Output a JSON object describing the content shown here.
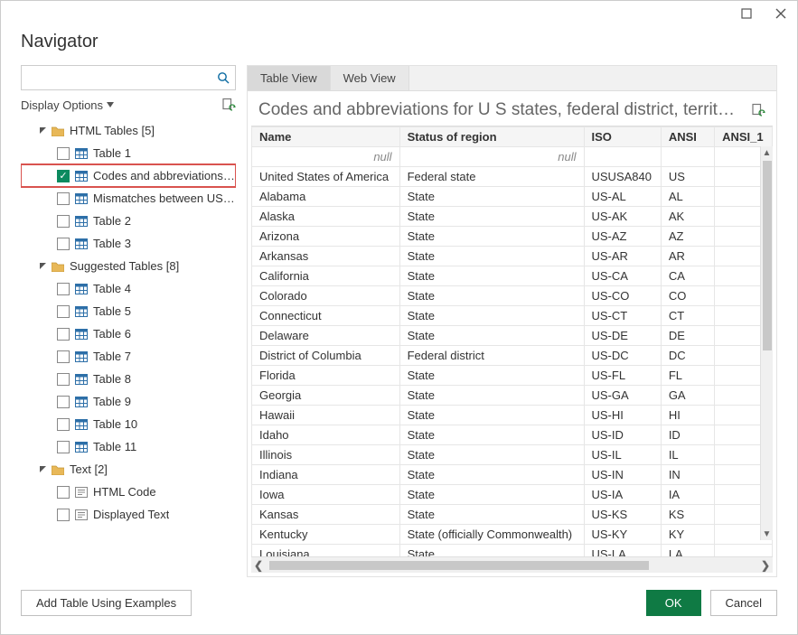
{
  "window": {
    "title": "Navigator"
  },
  "tabs": {
    "tableView": "Table View",
    "webView": "Web View"
  },
  "left": {
    "displayOptions": "Display Options",
    "groups": [
      {
        "label": "HTML Tables [5]",
        "items": [
          {
            "label": "Table 1",
            "checked": false,
            "highlight": false
          },
          {
            "label": "Codes and abbreviations f...",
            "checked": true,
            "highlight": true
          },
          {
            "label": "Mismatches between USP...",
            "checked": false,
            "highlight": false
          },
          {
            "label": "Table 2",
            "checked": false,
            "highlight": false
          },
          {
            "label": "Table 3",
            "checked": false,
            "highlight": false
          }
        ]
      },
      {
        "label": "Suggested Tables [8]",
        "items": [
          {
            "label": "Table 4",
            "checked": false
          },
          {
            "label": "Table 5",
            "checked": false
          },
          {
            "label": "Table 6",
            "checked": false
          },
          {
            "label": "Table 7",
            "checked": false
          },
          {
            "label": "Table 8",
            "checked": false
          },
          {
            "label": "Table 9",
            "checked": false
          },
          {
            "label": "Table 10",
            "checked": false
          },
          {
            "label": "Table 11",
            "checked": false
          }
        ]
      },
      {
        "label": "Text [2]",
        "items": [
          {
            "label": "HTML Code",
            "checked": false,
            "icon": "text"
          },
          {
            "label": "Displayed Text",
            "checked": false,
            "icon": "text"
          }
        ]
      }
    ]
  },
  "panel": {
    "title": "Codes and abbreviations for U S states, federal district, territories,..."
  },
  "table": {
    "columns": [
      "Name",
      "Status of region",
      "ISO",
      "ANSI",
      "ANSI_1"
    ],
    "nullRow": [
      "null",
      "null",
      "",
      "",
      ""
    ],
    "rows": [
      [
        "United States of America",
        "Federal state",
        "USUSA840",
        "US",
        ""
      ],
      [
        "Alabama",
        "State",
        "US-AL",
        "AL",
        ""
      ],
      [
        "Alaska",
        "State",
        "US-AK",
        "AK",
        ""
      ],
      [
        "Arizona",
        "State",
        "US-AZ",
        "AZ",
        ""
      ],
      [
        "Arkansas",
        "State",
        "US-AR",
        "AR",
        ""
      ],
      [
        "California",
        "State",
        "US-CA",
        "CA",
        ""
      ],
      [
        "Colorado",
        "State",
        "US-CO",
        "CO",
        ""
      ],
      [
        "Connecticut",
        "State",
        "US-CT",
        "CT",
        ""
      ],
      [
        "Delaware",
        "State",
        "US-DE",
        "DE",
        ""
      ],
      [
        "District of Columbia",
        "Federal district",
        "US-DC",
        "DC",
        ""
      ],
      [
        "Florida",
        "State",
        "US-FL",
        "FL",
        ""
      ],
      [
        "Georgia",
        "State",
        "US-GA",
        "GA",
        ""
      ],
      [
        "Hawaii",
        "State",
        "US-HI",
        "HI",
        ""
      ],
      [
        "Idaho",
        "State",
        "US-ID",
        "ID",
        ""
      ],
      [
        "Illinois",
        "State",
        "US-IL",
        "IL",
        ""
      ],
      [
        "Indiana",
        "State",
        "US-IN",
        "IN",
        ""
      ],
      [
        "Iowa",
        "State",
        "US-IA",
        "IA",
        ""
      ],
      [
        "Kansas",
        "State",
        "US-KS",
        "KS",
        ""
      ],
      [
        "Kentucky",
        "State (officially Commonwealth)",
        "US-KY",
        "KY",
        ""
      ],
      [
        "Louisiana",
        "State",
        "US-LA",
        "LA",
        ""
      ]
    ]
  },
  "footer": {
    "addTable": "Add Table Using Examples",
    "ok": "OK",
    "cancel": "Cancel"
  }
}
